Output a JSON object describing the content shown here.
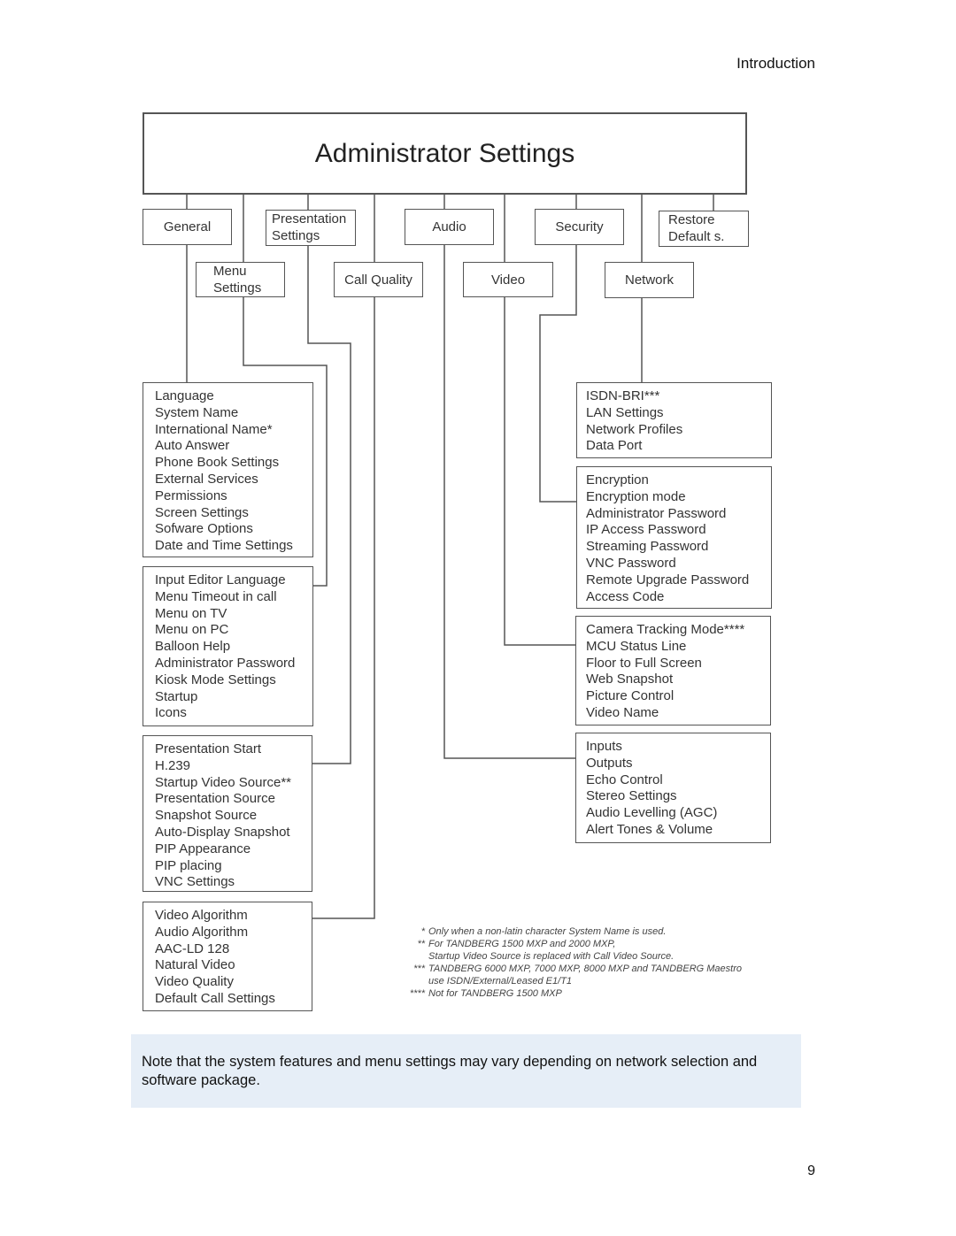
{
  "header": {
    "section": "Introduction"
  },
  "page_number": "9",
  "diagram": {
    "title": "Administrator Settings",
    "categories": {
      "general": "General",
      "menu": [
        "Menu",
        "Settings"
      ],
      "presentation": [
        "Presentation",
        "Settings"
      ],
      "call_quality": "Call Quality",
      "audio": "Audio",
      "video": "Video",
      "security": "Security",
      "network": "Network",
      "restore": [
        "Restore",
        "Default s."
      ]
    },
    "lists": {
      "general": [
        "Language",
        "System Name",
        "International Name*",
        "Auto Answer",
        "Phone Book Settings",
        "External Services",
        "Permissions",
        "Screen Settings",
        "Sofware Options",
        "Date and Time Settings"
      ],
      "menu": [
        "Input Editor Language",
        "Menu Timeout in call",
        "Menu on TV",
        "Menu on PC",
        "Balloon Help",
        "Administrator Password",
        "Kiosk Mode Settings",
        "Startup",
        "Icons"
      ],
      "presentation": [
        "Presentation Start",
        "H.239",
        "Startup Video Source**",
        "Presentation Source",
        "Snapshot Source",
        "Auto-Display Snapshot",
        "PIP Appearance",
        "PIP placing",
        "VNC Settings"
      ],
      "call_quality": [
        "Video Algorithm",
        "Audio Algorithm",
        "AAC-LD 128",
        "Natural Video",
        "Video Quality",
        "Default Call Settings"
      ],
      "network": [
        "ISDN-BRI***",
        "LAN Settings",
        "Network Profiles",
        "Data Port"
      ],
      "security": [
        "Encryption",
        "Encryption mode",
        "Administrator Password",
        "IP Access Password",
        "Streaming Password",
        "VNC Password",
        "Remote Upgrade Password",
        "Access Code"
      ],
      "video": [
        "Camera Tracking Mode****",
        "MCU Status Line",
        "Floor to Full Screen",
        "Web Snapshot",
        "Picture Control",
        "Video Name"
      ],
      "audio": [
        "Inputs",
        "Outputs",
        "Echo Control",
        "Stereo Settings",
        "Audio Levelling (AGC)",
        "Alert Tones & Volume"
      ]
    },
    "footnotes": [
      {
        "mark": "*",
        "text": "Only when a non-latin character System Name is used."
      },
      {
        "mark": "**",
        "text": "For TANDBERG 1500 MXP and 2000 MXP,"
      },
      {
        "mark": "",
        "text": "Startup Video Source is replaced with Call Video Source."
      },
      {
        "mark": "***",
        "text": "TANDBERG 6000 MXP, 7000 MXP, 8000 MXP and TANDBERG Maestro"
      },
      {
        "mark": "",
        "text": "use ISDN/External/Leased E1/T1"
      },
      {
        "mark": "****",
        "text": "Not for TANDBERG 1500 MXP"
      }
    ]
  },
  "note": {
    "text": "Note that the system features and menu settings may vary depending on network selection and software package."
  }
}
